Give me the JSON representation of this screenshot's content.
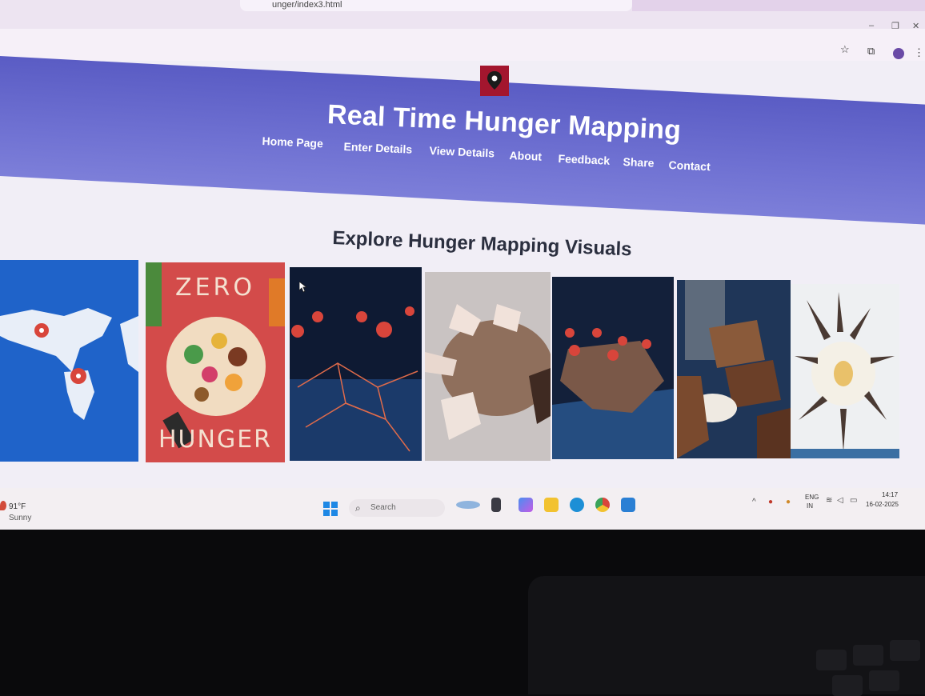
{
  "browser": {
    "url_text": "unger/index3.html"
  },
  "site": {
    "title": "Real Time Hunger Mapping",
    "nav": [
      "Home Page",
      "Enter Details",
      "View Details",
      "About",
      "Feedback",
      "Share",
      "Contact"
    ]
  },
  "main": {
    "section_title": "Explore Hunger Mapping Visuals",
    "cards": [
      {
        "icon": "world-map-pins-image"
      },
      {
        "top_text": "ZERO",
        "bottom_text": "HUNGER"
      },
      {
        "icon": "network-pins-image"
      },
      {
        "icon": "hands-globe-image"
      },
      {
        "icon": "glowing-map-pins-image"
      },
      {
        "icon": "hands-rice-image"
      },
      {
        "icon": "hands-circle-image"
      }
    ]
  },
  "taskbar": {
    "weather_temp": "91°F",
    "weather_condition": "Sunny",
    "search_label": "Search",
    "lang_line1": "ENG",
    "lang_line2": "IN",
    "time": "14:17",
    "date": "16-02-2025"
  },
  "colors": {
    "header": "#6264c8",
    "logo": "#a3162e",
    "accent_pin": "#d8453b"
  }
}
